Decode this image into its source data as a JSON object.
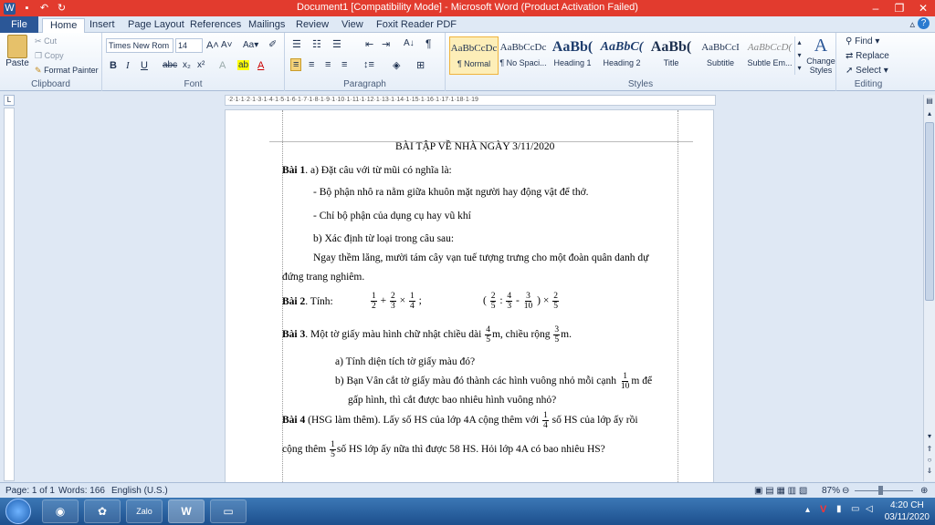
{
  "window": {
    "title": "Document1 [Compatibility Mode]  -  Microsoft Word (Product Activation Failed)"
  },
  "tabs": [
    "File",
    "Home",
    "Insert",
    "Page Layout",
    "References",
    "Mailings",
    "Review",
    "View",
    "Foxit Reader PDF"
  ],
  "ribbon": {
    "clipboard": {
      "label": "Clipboard",
      "paste": "Paste",
      "cut": "Cut",
      "copy": "Copy",
      "format_painter": "Format Painter"
    },
    "font": {
      "label": "Font",
      "font_name": "Times New Rom",
      "font_size": "14"
    },
    "paragraph": {
      "label": "Paragraph"
    },
    "styles": {
      "label": "Styles",
      "items": [
        {
          "sample": "AaBbCcDc",
          "name": "¶ Normal"
        },
        {
          "sample": "AaBbCcDc",
          "name": "¶ No Spaci..."
        },
        {
          "sample": "AaBb(",
          "name": "Heading 1"
        },
        {
          "sample": "AaBbC(",
          "name": "Heading 2"
        },
        {
          "sample": "AaBb(",
          "name": "Title"
        },
        {
          "sample": "AaBbCcI",
          "name": "Subtitle"
        },
        {
          "sample": "AaBbCcD(",
          "name": "Subtle Em..."
        }
      ],
      "change_styles": "Change Styles"
    },
    "editing": {
      "label": "Editing",
      "find": "Find",
      "replace": "Replace",
      "select": "Select"
    }
  },
  "document": {
    "title": "BÀI TẬP VỀ NHÀ NGÀY 3/11/2020",
    "bai1_label": "Bài 1",
    "bai1_a": ". a) Đặt câu với từ mũi có nghĩa là:",
    "bai1_a1": "- Bộ phận nhô ra nằm giữa khuôn mặt người hay động vật để thở.",
    "bai1_a2": "- Chỉ bộ phận của dụng cụ hay vũ khí",
    "bai1_b": "b) Xác định từ loại trong câu sau:",
    "bai1_b_line1": "Ngay thềm lăng, mười tám cây vạn tuế tượng trưng cho một đoàn quân danh dự",
    "bai1_b_line2": "đứng trang nghiêm.",
    "bai2_label": "Bài 2",
    "bai2_text": ". Tính:",
    "bai3_label": "Bài 3",
    "bai3_text1": ".     Một tờ giấy màu hình chữ nhật chiều dài",
    "bai3_text2": "m, chiều rộng",
    "bai3_text3": "m.",
    "bai3_a": "a)  Tính  diện tích tờ giấy màu đó?",
    "bai3_b1": "b)  Bạn Vân cắt tờ giấy màu đó thành các hình vuông nhỏ mỗi cạnh",
    "bai3_b2": "m để",
    "bai3_b3": "gấp hình, thì cắt được bao nhiêu hình vuông nhỏ?",
    "bai4_label": "Bài 4",
    "bai4_text1": " (HSG làm thêm). Lấy số HS của lớp 4A cộng thêm với",
    "bai4_text2": "số HS của lớp ấy rồi",
    "bai4_text3": "cộng thêm",
    "bai4_text4": "số HS lớp ấy nữa thì được 58 HS. Hỏi lớp 4A có bao  nhiêu HS?"
  },
  "status": {
    "page": "Page: 1 of 1",
    "words": "Words: 166",
    "language": "English (U.S.)",
    "zoom": "87%"
  },
  "taskbar": {
    "zalo": "Zalo",
    "word": "W",
    "time": "4:20 CH",
    "date": "03/11/2020"
  }
}
